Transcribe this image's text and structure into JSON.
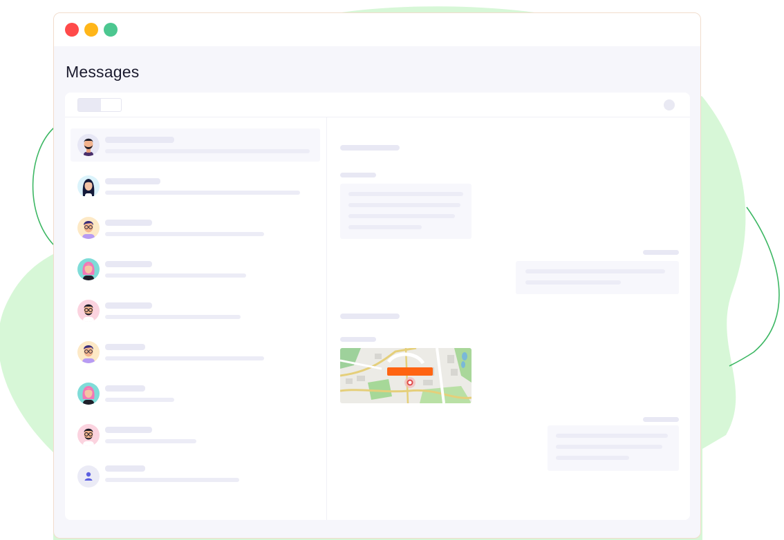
{
  "page": {
    "title": "Messages"
  },
  "colors": {
    "window_close": "#ff4a4a",
    "window_minimize": "#ffb619",
    "window_maximize": "#4cc790",
    "background_blob": "#d7f7d7",
    "background_line": "#3cb763",
    "map_label": "#ff6412"
  },
  "icons": {
    "close": "close-icon",
    "minimize": "minimize-icon",
    "maximize": "maximize-icon",
    "options": "more-options-icon",
    "location": "location-pin-icon",
    "user_placeholder": "user-icon"
  },
  "toggle": {
    "selected_option": 1,
    "option_count": 2
  },
  "conversations": [
    {
      "avatar": "man-beard-avatar",
      "selected": true
    },
    {
      "avatar": "woman-dark-hair-avatar",
      "selected": false
    },
    {
      "avatar": "man-glasses-purple-avatar",
      "selected": false
    },
    {
      "avatar": "woman-pink-hair-avatar",
      "selected": false
    },
    {
      "avatar": "man-glasses-beard-avatar",
      "selected": false
    },
    {
      "avatar": "man-glasses-purple-avatar",
      "selected": false
    },
    {
      "avatar": "woman-pink-hair-avatar",
      "selected": false
    },
    {
      "avatar": "man-glasses-beard-avatar",
      "selected": false
    },
    {
      "avatar": "user-placeholder-avatar",
      "selected": false
    }
  ],
  "messages": [
    {
      "direction": "incoming",
      "type": "text",
      "line_count": 4
    },
    {
      "direction": "outgoing",
      "type": "text",
      "line_count": 2
    },
    {
      "direction": "incoming",
      "type": "location"
    },
    {
      "direction": "outgoing",
      "type": "text",
      "line_count": 3
    }
  ]
}
